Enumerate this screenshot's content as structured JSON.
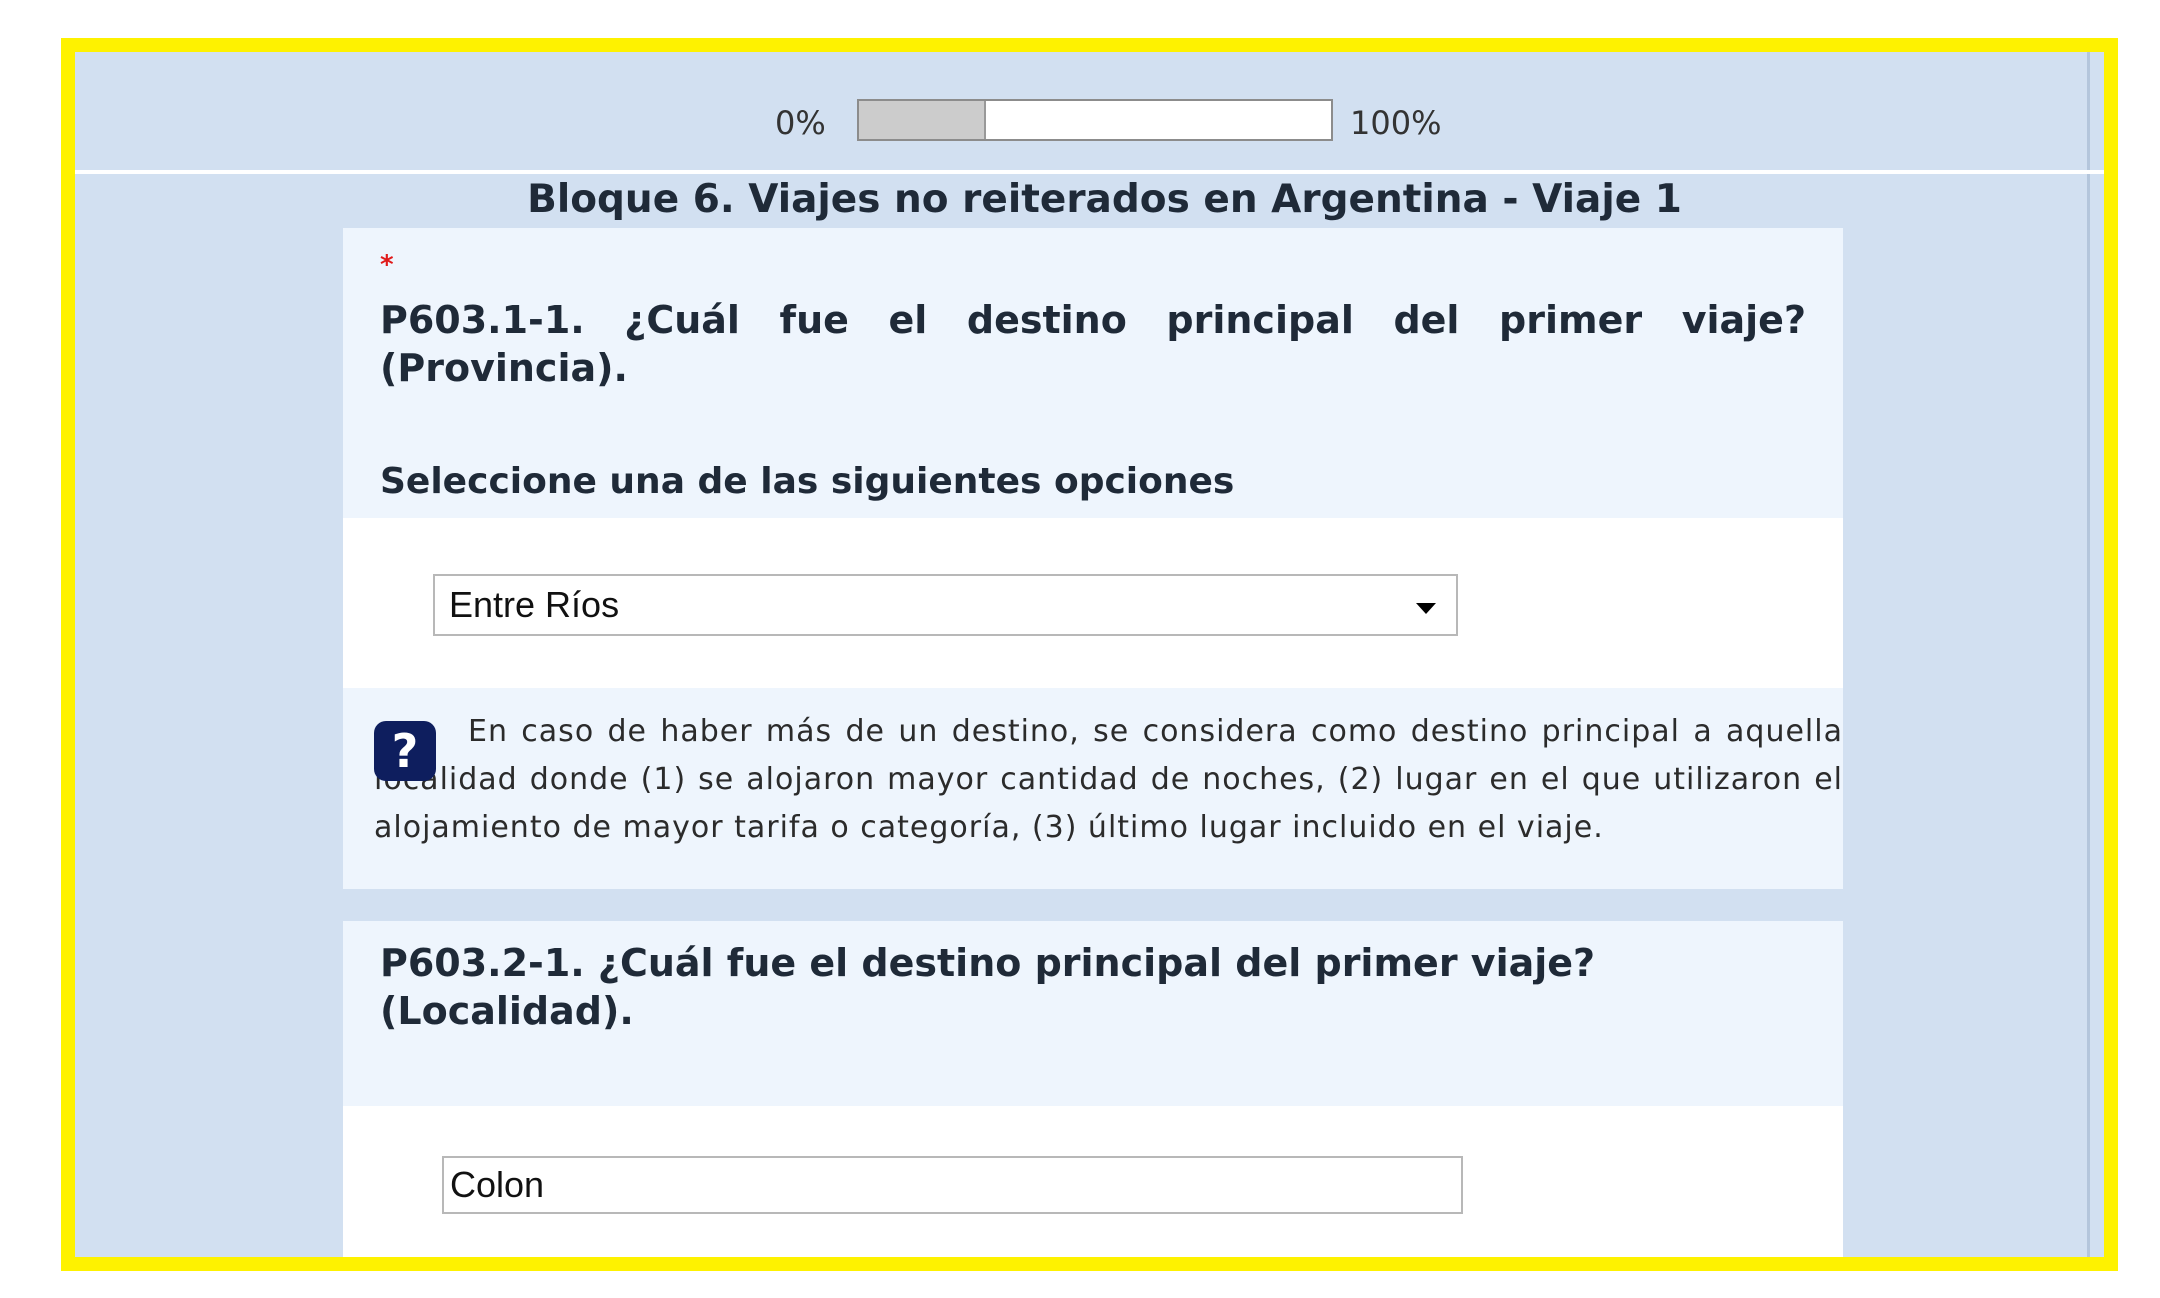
{
  "progress": {
    "min_label": "0%",
    "max_label": "100%",
    "value_percent": 27
  },
  "block": {
    "title": "Bloque 6. Viajes no reiterados en Argentina - Viaje 1"
  },
  "question1": {
    "required_marker": "*",
    "text": "P603.1-1. ¿Cuál fue el destino principal del primer viaje? (Provincia).",
    "instruction": "Seleccione una de las siguientes opciones",
    "selected_value": "Entre Ríos",
    "help_text": "En caso de haber más de un destino, se considera como destino principal a aquella localidad donde (1) se alojaron mayor cantidad de noches, (2) lugar en el que utilizaron el alojamiento de mayor tarifa o categoría, (3) último lugar incluido en el viaje."
  },
  "question2": {
    "text": "P603.2-1. ¿Cuál fue el destino principal del primer viaje? (Localidad).",
    "input_value": "Colon"
  },
  "icons": {
    "help_glyph": "?"
  },
  "colors": {
    "frame": "#fef200",
    "background": "#d2e0f1",
    "help_icon": "#0e1e5e",
    "required": "#e01a1a"
  }
}
